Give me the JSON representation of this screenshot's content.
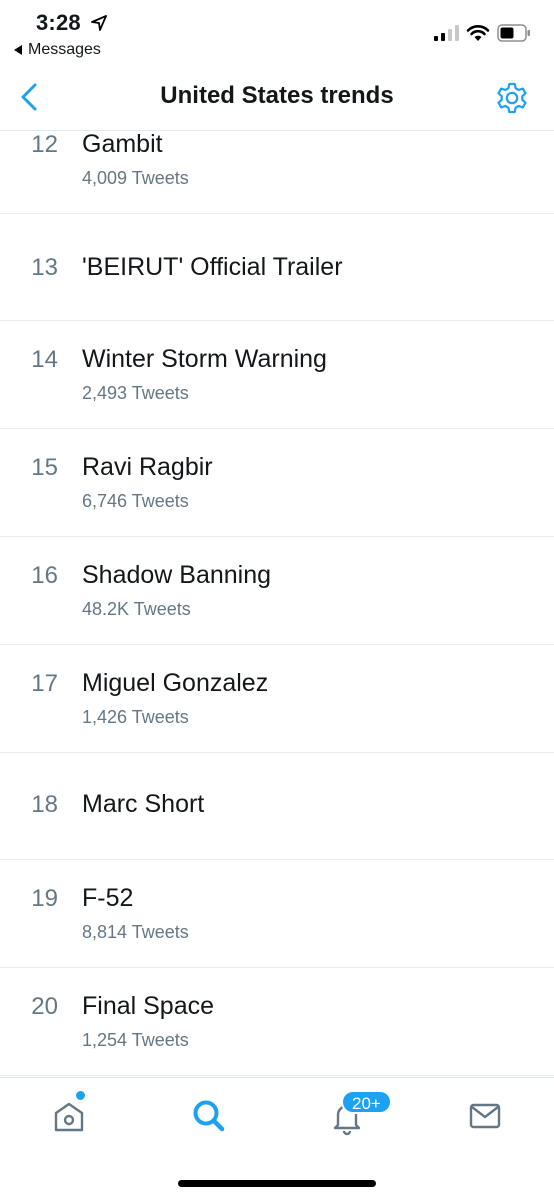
{
  "status_bar": {
    "time": "3:28",
    "back_app_label": "Messages"
  },
  "nav": {
    "title": "United States trends",
    "back_icon": "chevron-left-icon",
    "settings_icon": "gear-icon"
  },
  "trends": [
    {
      "rank": "12",
      "name": "Gambit",
      "count": "4,009 Tweets"
    },
    {
      "rank": "13",
      "name": "'BEIRUT' Official Trailer",
      "count": ""
    },
    {
      "rank": "14",
      "name": "Winter Storm Warning",
      "count": "2,493 Tweets"
    },
    {
      "rank": "15",
      "name": "Ravi Ragbir",
      "count": "6,746 Tweets"
    },
    {
      "rank": "16",
      "name": "Shadow Banning",
      "count": "48.2K Tweets"
    },
    {
      "rank": "17",
      "name": "Miguel Gonzalez",
      "count": "1,426 Tweets"
    },
    {
      "rank": "18",
      "name": "Marc Short",
      "count": ""
    },
    {
      "rank": "19",
      "name": "F-52",
      "count": "8,814 Tweets"
    },
    {
      "rank": "20",
      "name": "Final Space",
      "count": "1,254 Tweets"
    }
  ],
  "tab_bar": {
    "notifications_badge": "20+",
    "items": [
      "home-icon",
      "search-icon",
      "bell-icon",
      "mail-icon"
    ]
  },
  "colors": {
    "accent": "#1da1f2",
    "muted": "#657786",
    "text": "#14171a",
    "divider": "#e6ecf0"
  }
}
